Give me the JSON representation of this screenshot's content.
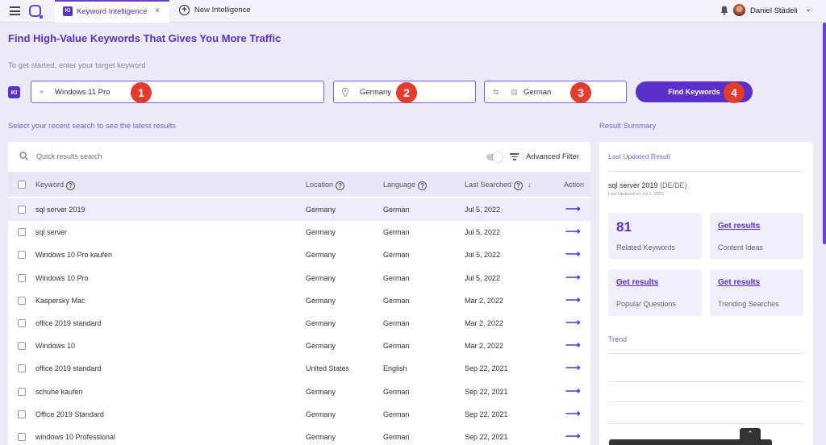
{
  "app": {
    "tab_active_badge": "KI",
    "tab_active_label": "Keyword Intelligence",
    "tab_close": "×",
    "new_tab_label": "New Intelligence",
    "new_tab_plus": "+",
    "user_name": "Daniel Städeli",
    "user_chevron": "⌄",
    "accent_color": "#5b2fc9",
    "marker_color": "#e23d2c"
  },
  "header": {
    "title": "Find High-Value Keywords That Gives You More Traffic",
    "intro": "To get started, enter your target keyword"
  },
  "form": {
    "badge": "KI",
    "keyword_value": "Windows 11 Pro",
    "location_value": "Germany",
    "language_value": "German",
    "find_label": "Find Keywords",
    "markers": [
      "1",
      "2",
      "3",
      "4"
    ]
  },
  "recent": {
    "label": "Select your recent search to see the latest results",
    "search_placeholder": "Quick results search",
    "advanced_filter": "Advanced Filter",
    "columns": [
      "Keyword",
      "Location",
      "Language",
      "Last Searched",
      "Action"
    ],
    "sort_arrow": "↓",
    "action_arrow": "⟶",
    "rows": [
      {
        "keyword": "sql server 2019",
        "location": "Germany",
        "language": "German",
        "date": "Jul 5, 2022"
      },
      {
        "keyword": "sql server",
        "location": "Germany",
        "language": "German",
        "date": "Jul 5, 2022"
      },
      {
        "keyword": "Windows 10 Pro kaufen",
        "location": "Germany",
        "language": "German",
        "date": "Jul 5, 2022"
      },
      {
        "keyword": "Windows 10 Pro",
        "location": "Germany",
        "language": "German",
        "date": "Jul 5, 2022"
      },
      {
        "keyword": "Kaspersky Mac",
        "location": "Germany",
        "language": "German",
        "date": "Mar 2, 2022"
      },
      {
        "keyword": "office 2019 standard",
        "location": "Germany",
        "language": "German",
        "date": "Mar 2, 2022"
      },
      {
        "keyword": "Windows 10",
        "location": "Germany",
        "language": "German",
        "date": "Mar 2, 2022"
      },
      {
        "keyword": "office 2019 standard",
        "location": "United States",
        "language": "English",
        "date": "Sep 22, 2021"
      },
      {
        "keyword": "schuhe kaufen",
        "location": "Germany",
        "language": "German",
        "date": "Sep 22, 2021"
      },
      {
        "keyword": "Office 2019 Standard",
        "location": "Germany",
        "language": "German",
        "date": "Sep 22, 2021"
      },
      {
        "keyword": "windows 10 Professional",
        "location": "Germany",
        "language": "German",
        "date": "Sep 22, 2021"
      }
    ]
  },
  "summary": {
    "label": "Result Summary",
    "last_updated": "Last Updated Result",
    "keyword": "sql server 2019",
    "keyword_locale": "(DE/DE)",
    "updated_on": "Last Updated on Jul 5, 2022",
    "related_count": "81",
    "related_caption": "Related Keywords",
    "get_results": "Get results",
    "content_ideas": "Content Ideas",
    "popular_questions": "Popular Questions",
    "trending_searches": "Trending Searches",
    "trend": "Trend"
  }
}
